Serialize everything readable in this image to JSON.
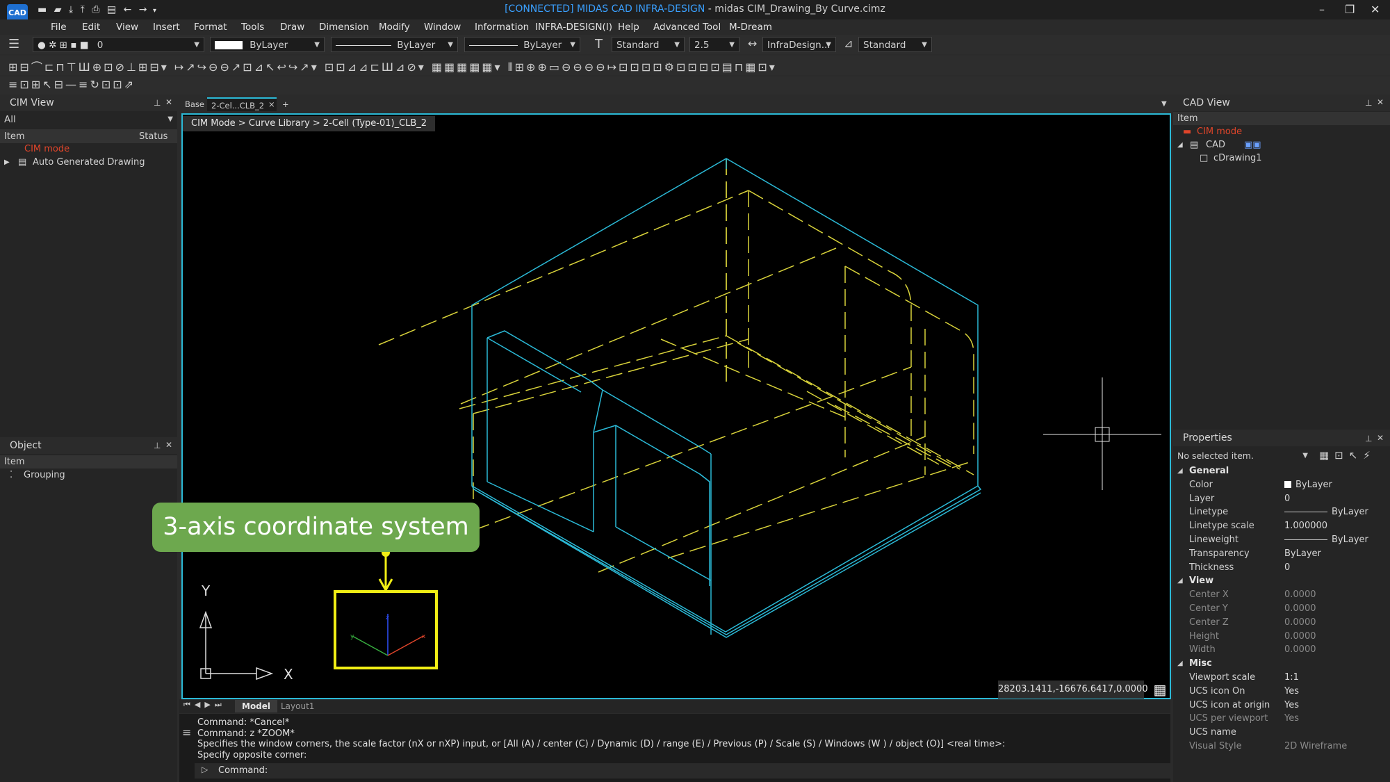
{
  "app": {
    "logo_text": "CAD",
    "title_connected": "[CONNECTED] MIDAS CAD INFRA-DESIGN",
    "title_rest": " - midas CIM_Drawing_By Curve.cimz"
  },
  "menu": [
    "File",
    "Edit",
    "View",
    "Insert",
    "Format",
    "Tools",
    "Draw",
    "Dimension",
    "Modify",
    "Window",
    "Information",
    "INFRA-DESIGN(I)",
    "Help",
    "Advanced Tool",
    "M-Dream"
  ],
  "toolbar": {
    "layer_value": "0",
    "color_value": "ByLayer",
    "linetype_value": "ByLayer",
    "lineweight_value": "ByLayer",
    "text_style": "Standard",
    "text_height": "2.5",
    "dim_style": "InfraDesign...",
    "table_style": "Standard"
  },
  "cim_view": {
    "title": "CIM View",
    "filter": "All",
    "col_item": "Item",
    "col_status": "Status",
    "items": [
      "CIM mode",
      "Auto Generated Drawing"
    ]
  },
  "object_panel": {
    "title": "Object",
    "header": "Item",
    "items": [
      "Grouping"
    ]
  },
  "doc_tabs": {
    "base": "Base",
    "active": "2-Cel...CLB_2",
    "close": "×",
    "add": "+"
  },
  "breadcrumb": "CIM Mode > Curve Library > 2-Cell (Type-01)_CLB_2",
  "viewport": {
    "axis_x": "X",
    "axis_y": "Y",
    "callout": "3-axis coordinate system",
    "coords": "28203.1411,-16676.6417,0.0000"
  },
  "layout_tabs": [
    "Model",
    "Layout1"
  ],
  "command": {
    "lines": [
      "Command:  *Cancel*",
      "Command:  z *ZOOM*",
      "Specifies the window corners, the scale factor (nX or nXP) input, or [All (A) / center (C) / Dynamic (D) / range (E) / Previous (P) / Scale (S) / Windows (W ) / object (O)] <real time>:",
      "Specify opposite corner:"
    ],
    "prompt": "Command:"
  },
  "cad_view": {
    "title": "CAD View",
    "header": "Item",
    "items": [
      "CIM mode",
      "CAD",
      "cDrawing1"
    ]
  },
  "properties": {
    "title": "Properties",
    "selection": "No selected item.",
    "sections": [
      {
        "name": "General",
        "rows": [
          {
            "label": "Color",
            "value": "ByLayer"
          },
          {
            "label": "Layer",
            "value": "0"
          },
          {
            "label": "Linetype",
            "value": "ByLayer"
          },
          {
            "label": "Linetype scale",
            "value": "1.000000"
          },
          {
            "label": "Lineweight",
            "value": "ByLayer"
          },
          {
            "label": "Transparency",
            "value": "ByLayer"
          },
          {
            "label": "Thickness",
            "value": "0"
          }
        ]
      },
      {
        "name": "View",
        "rows": [
          {
            "label": "Center X",
            "value": "0.0000"
          },
          {
            "label": "Center Y",
            "value": "0.0000"
          },
          {
            "label": "Center Z",
            "value": "0.0000"
          },
          {
            "label": "Height",
            "value": "0.0000"
          },
          {
            "label": "Width",
            "value": "0.0000"
          }
        ]
      },
      {
        "name": "Misc",
        "rows": [
          {
            "label": "Viewport scale",
            "value": "1:1"
          },
          {
            "label": "UCS icon On",
            "value": "Yes"
          },
          {
            "label": "UCS icon at origin",
            "value": "Yes"
          },
          {
            "label": "UCS per viewport",
            "value": "Yes"
          },
          {
            "label": "UCS name",
            "value": ""
          },
          {
            "label": "Visual Style",
            "value": "2D Wireframe"
          }
        ]
      }
    ]
  },
  "colors": {
    "cyan": "#2bb9d6",
    "yellow": "#d8d23a",
    "accent_red": "#e0452a",
    "callout_green": "#6da84e",
    "highlight": "#f1ee15"
  }
}
